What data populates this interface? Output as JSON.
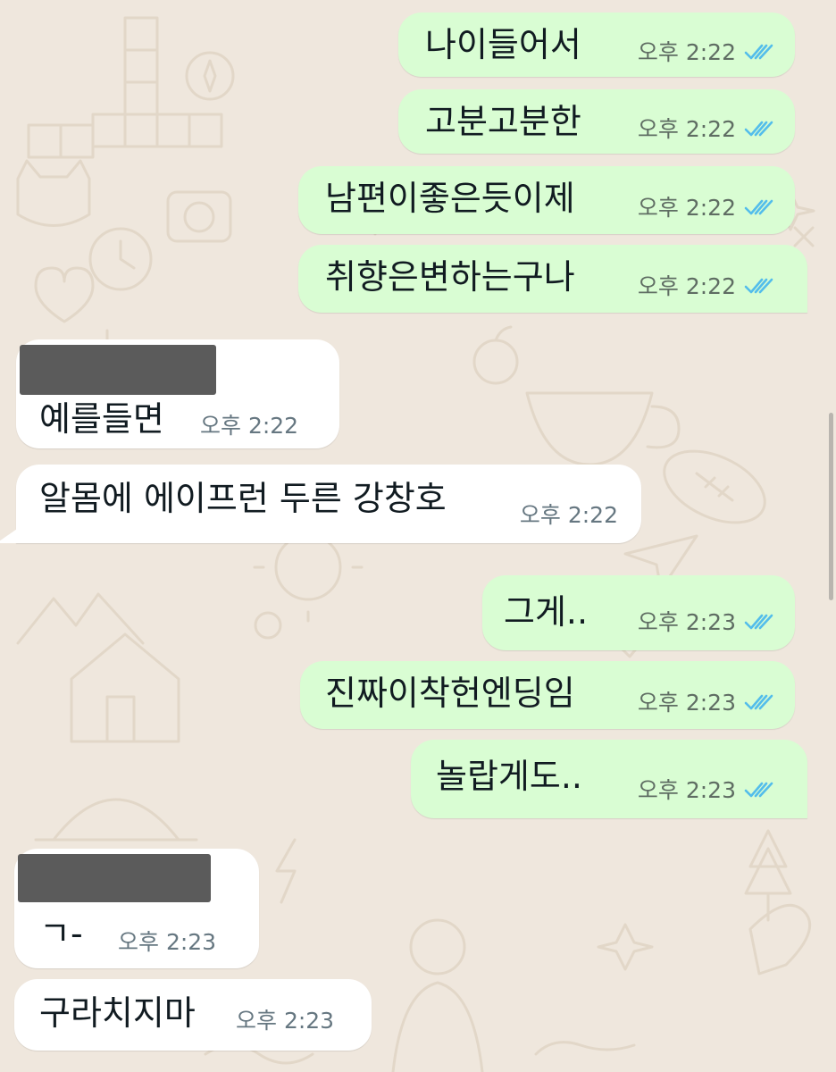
{
  "theme": {
    "outgoing_bubble": "#D9FDD3",
    "incoming_bubble": "#FFFFFF",
    "read_tick_color": "#53BDEB",
    "wallpaper_color": "#EFE7DD"
  },
  "messages": [
    {
      "direction": "outgoing",
      "text": "나이들어서",
      "time": "오후 2:22",
      "status": "read-ticks-icon"
    },
    {
      "direction": "outgoing",
      "text": "고분고분한",
      "time": "오후 2:22",
      "status": "read-ticks-icon"
    },
    {
      "direction": "outgoing",
      "text": "남편이좋은듯이제",
      "time": "오후 2:22",
      "status": "read-ticks-icon"
    },
    {
      "direction": "outgoing",
      "text": "취향은변하는구나",
      "time": "오후 2:22",
      "status": "read-ticks-icon"
    },
    {
      "direction": "incoming",
      "sender_redacted": true,
      "text": "예를들면",
      "time": "오후 2:22"
    },
    {
      "direction": "incoming",
      "text": "알몸에 에이프런 두른 강창호",
      "time": "오후 2:22"
    },
    {
      "direction": "outgoing",
      "text": "그게..",
      "time": "오후 2:23",
      "status": "read-ticks-icon"
    },
    {
      "direction": "outgoing",
      "text": "진짜이착헌엔딩임",
      "time": "오후 2:23",
      "status": "read-ticks-icon"
    },
    {
      "direction": "outgoing",
      "text": "놀랍게도..",
      "time": "오후 2:23",
      "status": "read-ticks-icon"
    },
    {
      "direction": "incoming",
      "sender_redacted": true,
      "text": "ㄱ-",
      "time": "오후 2:23"
    },
    {
      "direction": "incoming",
      "text": "구라치지마",
      "time": "오후 2:23"
    }
  ]
}
